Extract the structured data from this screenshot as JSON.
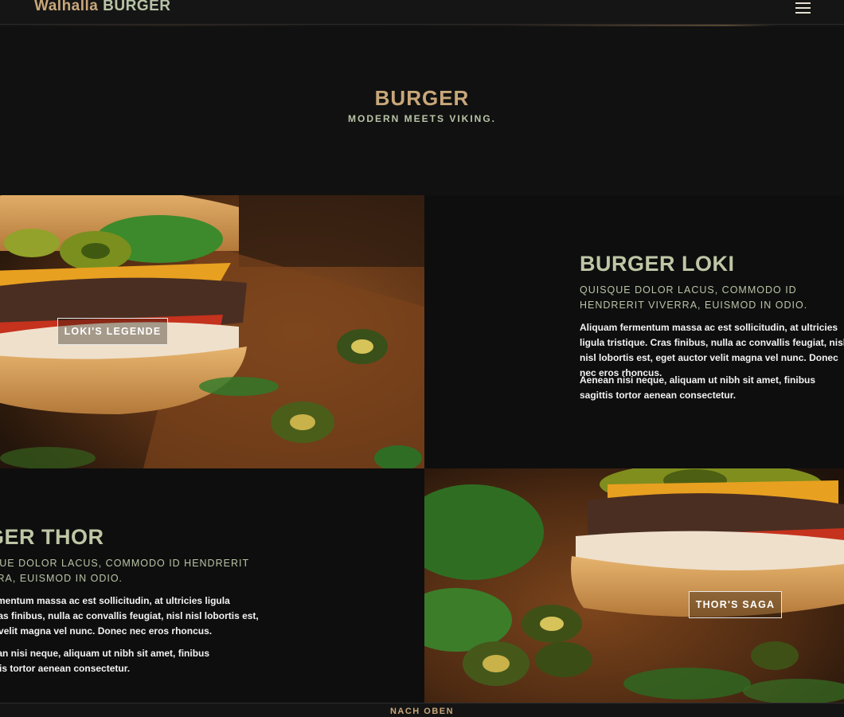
{
  "header": {
    "brand_part1": "Walhalla",
    "brand_part2": "BURGER",
    "menu_icon": "hamburger-menu-icon"
  },
  "section": {
    "title": "BURGER",
    "subtitle": "MODERN MEETS VIKING."
  },
  "items": [
    {
      "title": "BURGER LOKI",
      "subtitle": "QUISQUE DOLOR LACUS, COMMODO ID HENDRERIT VIVERRA, EUISMOD IN ODIO.",
      "paragraph1": "Aliquam fermentum massa ac est sollicitudin, at ultricies ligula tristique. Cras finibus, nulla ac convallis feugiat, nisl nisl lobortis est, eget auctor velit magna vel nunc. Donec nec eros rhoncus.",
      "paragraph2": "Aenean nisi neque, aliquam ut nibh sit amet, finibus sagittis tortor aenean consectetur.",
      "button_label": "LOKI'S LEGENDE"
    },
    {
      "title": "BURGER THOR",
      "subtitle": "QUISQUE DOLOR LACUS, COMMODO ID HENDRERIT VIVERRA, EUISMOD IN ODIO.",
      "paragraph1": "Aliquam fermentum massa ac est sollicitudin, at ultricies ligula tristique. Cras finibus, nulla ac convallis feugiat, nisl nisl lobortis est, eget auctor velit magna vel nunc. Donec nec eros rhoncus.",
      "paragraph2": "Aenean nisi neque, aliquam ut nibh sit amet, finibus sagittis tortor aenean consectetur.",
      "button_label": "THOR'S SAGA"
    }
  ],
  "footer": {
    "back_to_top": "NACH OBEN"
  },
  "colors": {
    "background": "#111111",
    "accent_gold": "#c9a77a",
    "accent_sage": "#b8c4a6",
    "body_text": "#f2f2f2"
  }
}
